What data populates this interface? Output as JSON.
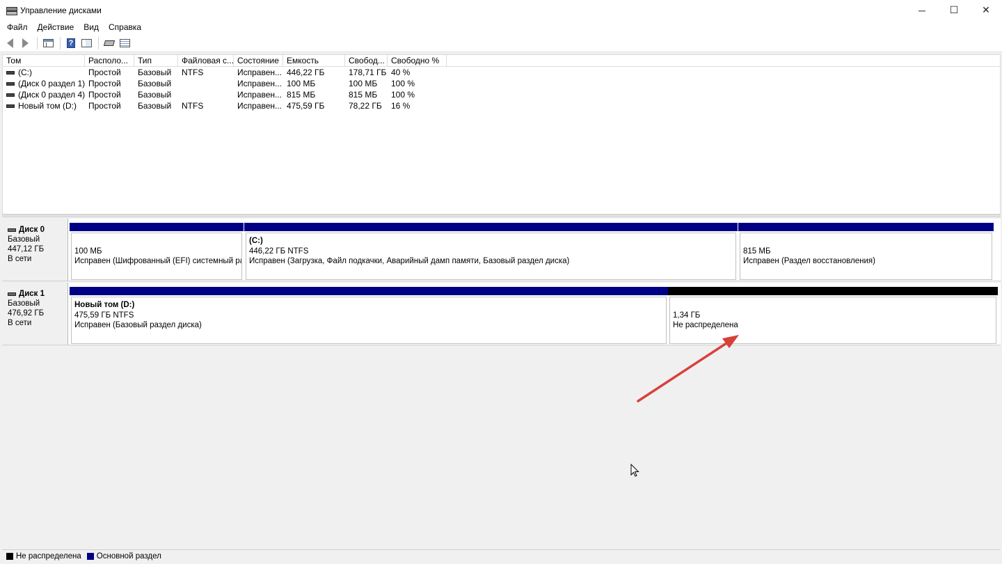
{
  "window": {
    "title": "Управление дисками",
    "controls": {
      "minimize": "─",
      "maximize": "☐",
      "close": "✕"
    }
  },
  "menu": [
    "Файл",
    "Действие",
    "Вид",
    "Справка"
  ],
  "toolbar": {
    "icons": [
      "back-icon",
      "forward-icon",
      "show-hide-console-tree-icon",
      "help-icon",
      "properties-icon",
      "rescan-disks-icon",
      "list-view-icon"
    ]
  },
  "volume_table": {
    "columns": [
      "Том",
      "Располо...",
      "Тип",
      "Файловая с...",
      "Состояние",
      "Емкость",
      "Свобод...",
      "Свободно %"
    ],
    "rows": [
      {
        "name": "(C:)",
        "layout": "Простой",
        "type": "Базовый",
        "fs": "NTFS",
        "status": "Исправен...",
        "capacity": "446,22 ГБ",
        "free": "178,71 ГБ",
        "free_pct": "40 %"
      },
      {
        "name": "(Диск 0 раздел 1)",
        "layout": "Простой",
        "type": "Базовый",
        "fs": "",
        "status": "Исправен...",
        "capacity": "100 МБ",
        "free": "100 МБ",
        "free_pct": "100 %"
      },
      {
        "name": "(Диск 0 раздел 4)",
        "layout": "Простой",
        "type": "Базовый",
        "fs": "",
        "status": "Исправен...",
        "capacity": "815 МБ",
        "free": "815 МБ",
        "free_pct": "100 %"
      },
      {
        "name": "Новый том (D:)",
        "layout": "Простой",
        "type": "Базовый",
        "fs": "NTFS",
        "status": "Исправен...",
        "capacity": "475,59 ГБ",
        "free": "78,22 ГБ",
        "free_pct": "16 %"
      }
    ]
  },
  "disks": [
    {
      "name": "Диск 0",
      "type": "Базовый",
      "size": "447,12 ГБ",
      "status": "В сети",
      "partitions": [
        {
          "title": "",
          "size": "100 МБ",
          "status": "Исправен (Шифрованный (EFI) системный раз",
          "kind": "primary"
        },
        {
          "title": "(C:)",
          "size": "446,22 ГБ NTFS",
          "status": "Исправен (Загрузка, Файл подкачки, Аварийный дамп памяти, Базовый раздел диска)",
          "kind": "primary"
        },
        {
          "title": "",
          "size": "815 МБ",
          "status": "Исправен (Раздел восстановления)",
          "kind": "primary"
        }
      ]
    },
    {
      "name": "Диск 1",
      "type": "Базовый",
      "size": "476,92 ГБ",
      "status": "В сети",
      "partitions": [
        {
          "title": "Новый том  (D:)",
          "size": "475,59 ГБ NTFS",
          "status": "Исправен (Базовый раздел диска)",
          "kind": "primary"
        },
        {
          "title": "",
          "size": "1,34 ГБ",
          "status": "Не распределена",
          "kind": "unallocated"
        }
      ]
    }
  ],
  "legend": [
    {
      "label": "Не распределена",
      "color": "#000000"
    },
    {
      "label": "Основной раздел",
      "color": "#000084"
    }
  ],
  "colors": {
    "primary": "#000084",
    "unallocated": "#000000",
    "annotation_arrow": "#d9403a"
  }
}
